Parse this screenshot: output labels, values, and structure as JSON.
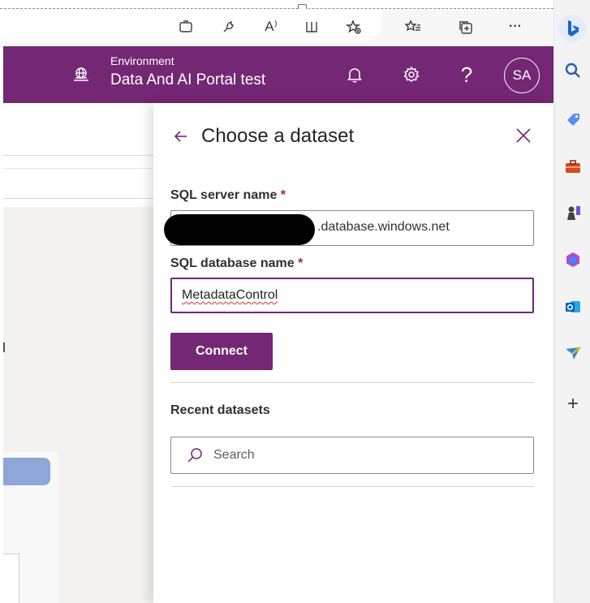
{
  "browser": {
    "toolbar_icons": [
      "tab-icon",
      "extensions-icon",
      "read-aloud-icon",
      "split-screen-icon",
      "add-favorite-icon",
      "favorites-icon",
      "collections-icon",
      "more-icon"
    ],
    "read_aloud_label": "A⁾",
    "more_label": "···",
    "sidebar_icons": [
      "bing-copilot-icon",
      "search-icon",
      "shopping-icon",
      "tools-icon",
      "games-icon",
      "microsoft365-icon",
      "outlook-icon",
      "drop-icon",
      "add-icon"
    ],
    "add_label": "+"
  },
  "header": {
    "environment_label": "Environment",
    "environment_name": "Data And AI Portal test",
    "avatar_initials": "SA",
    "help_label": "?"
  },
  "panel": {
    "title": "Choose a dataset",
    "server_field": {
      "label": "SQL server name",
      "required_mark": " *",
      "value_suffix": ".database.windows.net"
    },
    "database_field": {
      "label": "SQL database name",
      "required_mark": " *",
      "value": "MetadataControl"
    },
    "connect_label": "Connect",
    "recent_title": "Recent datasets",
    "search_placeholder": "Search"
  },
  "colors": {
    "brand": "#742774",
    "required": "#a4262c",
    "spellcheck": "#d13438",
    "redaction": "#000000"
  }
}
